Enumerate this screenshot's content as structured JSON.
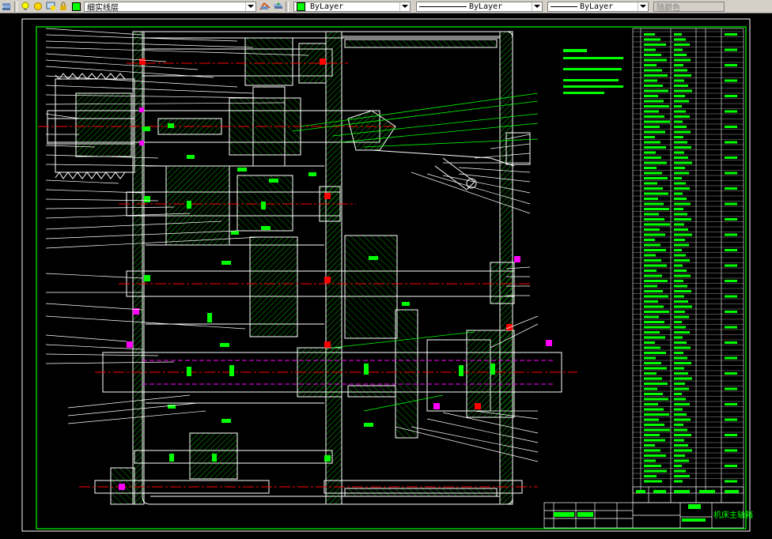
{
  "toolbar": {
    "layer_name": "细实线层",
    "color_value": "ByLayer",
    "linetype_value": "ByLayer",
    "lineweight_value": "ByLayer",
    "plotstyle_value": "随颜色",
    "colors": {
      "layer_swatch": "#00ff00",
      "color_swatch": "#00ff00"
    }
  },
  "drawing": {
    "background": "#000000",
    "border_color": "#00ff00",
    "line_color": "#ffffff",
    "center_line_color": "#ff0000",
    "hidden_line_color": "#ff00ff",
    "annotation_color": "#00ff00",
    "title_block_label": "机床主轴箱"
  }
}
